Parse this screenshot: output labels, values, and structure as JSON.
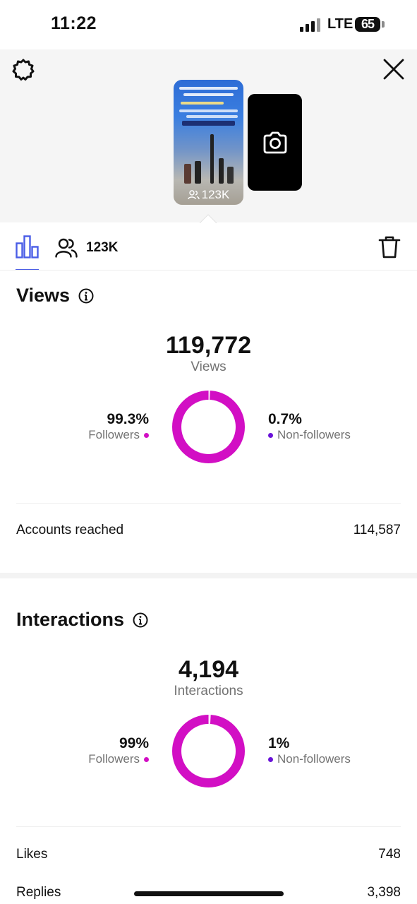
{
  "status_bar": {
    "time": "11:22",
    "network": "LTE",
    "battery": "65"
  },
  "story": {
    "view_count": "123K"
  },
  "tabs": {
    "audience_count": "123K"
  },
  "views": {
    "title": "Views",
    "total": "119,772",
    "total_label": "Views",
    "followers_pct": "99.3%",
    "followers_label": "Followers",
    "nonfollowers_pct": "0.7%",
    "nonfollowers_label": "Non-followers",
    "followers_fraction": 0.993,
    "accounts_reached_label": "Accounts reached",
    "accounts_reached_value": "114,587"
  },
  "interactions": {
    "title": "Interactions",
    "total": "4,194",
    "total_label": "Interactions",
    "followers_pct": "99%",
    "followers_label": "Followers",
    "nonfollowers_pct": "1%",
    "nonfollowers_label": "Non-followers",
    "followers_fraction": 0.99,
    "rows": [
      {
        "label": "Likes",
        "value": "748"
      },
      {
        "label": "Replies",
        "value": "3,398"
      }
    ]
  },
  "colors": {
    "followers": "#d20fc4",
    "nonfollowers": "#6a12d8",
    "accent": "#4a5de6"
  },
  "icons": [
    "settings-gear-icon",
    "close-icon",
    "camera-icon",
    "bar-chart-icon",
    "people-icon",
    "trash-icon",
    "info-icon"
  ]
}
